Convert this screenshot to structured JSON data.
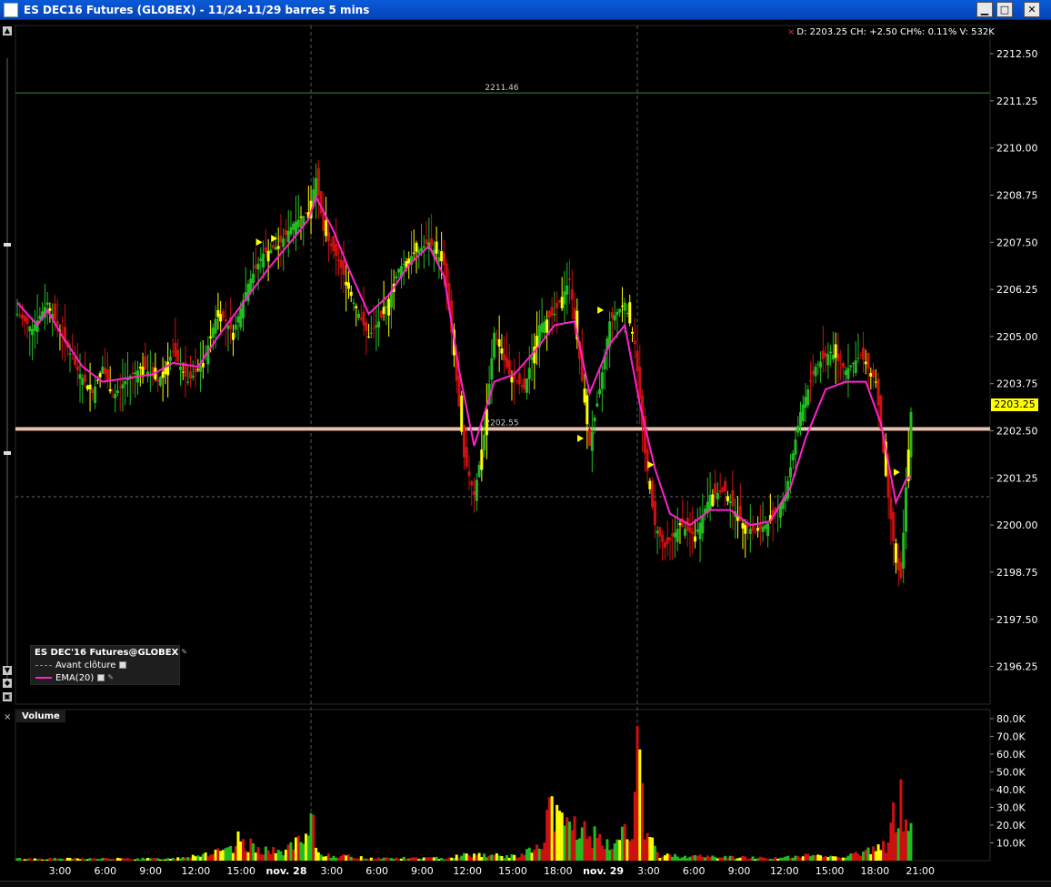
{
  "window": {
    "title": "ES DEC16 Futures (GLOBEX) - 11/24-11/29 barres 5 mins",
    "minimize_glyph": "▁",
    "maximize_glyph": "□",
    "close_glyph": "✕"
  },
  "info_line": {
    "close_glyph": "×",
    "text": "D: 2203.25 CH: +2.50 CH%: 0.11% V: 532K"
  },
  "last_price_label": "2203.25",
  "legend": {
    "title": "ES DEC'16 Futures@GLOBEX",
    "items": [
      {
        "label": "Avant clôture",
        "style": "dashed",
        "color": "#888888"
      },
      {
        "label": "EMA(20)",
        "style": "solid",
        "color": "#ff22cc"
      }
    ]
  },
  "volume_panel": {
    "label": "Volume",
    "close_glyph": "×"
  },
  "colors": {
    "up": "#22bb22",
    "down": "#cc1111",
    "neutral": "#ffff00",
    "ema": "#ff22cc",
    "grid": "#2a3a2a",
    "axis_text": "#ffffff",
    "reference_line_upper": "#2f8f2f",
    "reference_line_lower": "#e8c0b0",
    "marker": "#ffff00"
  },
  "chart_data": {
    "type": "candlestick",
    "price_axis": {
      "ticks": [
        "2212.50",
        "2211.25",
        "2210.00",
        "2208.75",
        "2207.50",
        "2206.25",
        "2205.00",
        "2203.75",
        "2202.50",
        "2201.25",
        "2200.00",
        "2198.75",
        "2197.50",
        "2196.25"
      ],
      "range": [
        2195.25,
        2213.25
      ]
    },
    "time_axis": {
      "labels": [
        "3:00",
        "6:00",
        "9:00",
        "12:00",
        "15:00",
        "nov. 28",
        "3:00",
        "6:00",
        "9:00",
        "12:00",
        "15:00",
        "18:00",
        "nov. 29",
        "3:00",
        "6:00",
        "9:00",
        "12:00",
        "15:00",
        "18:00",
        "21:00"
      ],
      "bold": [
        false,
        false,
        false,
        false,
        false,
        true,
        false,
        false,
        false,
        false,
        false,
        false,
        true,
        false,
        false,
        false,
        false,
        false,
        false,
        false
      ]
    },
    "reference_lines": [
      {
        "label": "2211.46",
        "value": 2211.46
      },
      {
        "label": "2202.55",
        "value": 2202.55
      }
    ],
    "pre_close_value": 2200.75,
    "price_path": [
      [
        0,
        2205.6
      ],
      [
        6,
        2205.2
      ],
      [
        12,
        2205.9
      ],
      [
        18,
        2205.0
      ],
      [
        24,
        2204.1
      ],
      [
        30,
        2203.5
      ],
      [
        34,
        2204.2
      ],
      [
        38,
        2203.4
      ],
      [
        44,
        2203.9
      ],
      [
        50,
        2204.2
      ],
      [
        56,
        2203.8
      ],
      [
        62,
        2204.6
      ],
      [
        68,
        2203.8
      ],
      [
        74,
        2204.3
      ],
      [
        80,
        2205.7
      ],
      [
        86,
        2205.1
      ],
      [
        92,
        2206.4
      ],
      [
        98,
        2207.2
      ],
      [
        104,
        2207.4
      ],
      [
        110,
        2208.0
      ],
      [
        116,
        2208.3
      ],
      [
        119,
        2209.2
      ],
      [
        122,
        2207.8
      ],
      [
        128,
        2207.0
      ],
      [
        134,
        2205.9
      ],
      [
        140,
        2205.0
      ],
      [
        146,
        2205.6
      ],
      [
        152,
        2206.8
      ],
      [
        158,
        2207.2
      ],
      [
        164,
        2207.5
      ],
      [
        170,
        2206.9
      ],
      [
        174,
        2204.5
      ],
      [
        178,
        2201.8
      ],
      [
        182,
        2200.8
      ],
      [
        186,
        2202.4
      ],
      [
        190,
        2205.1
      ],
      [
        196,
        2204.0
      ],
      [
        202,
        2203.6
      ],
      [
        208,
        2205.3
      ],
      [
        214,
        2205.6
      ],
      [
        220,
        2206.5
      ],
      [
        224,
        2204.4
      ],
      [
        228,
        2202.1
      ],
      [
        232,
        2203.6
      ],
      [
        236,
        2205.4
      ],
      [
        242,
        2205.9
      ],
      [
        246,
        2204.8
      ],
      [
        250,
        2201.9
      ],
      [
        254,
        2200.0
      ],
      [
        258,
        2199.4
      ],
      [
        264,
        2200.0
      ],
      [
        270,
        2199.7
      ],
      [
        276,
        2200.8
      ],
      [
        282,
        2200.9
      ],
      [
        288,
        2200.1
      ],
      [
        294,
        2199.8
      ],
      [
        300,
        2200.1
      ],
      [
        306,
        2200.8
      ],
      [
        312,
        2203.0
      ],
      [
        318,
        2204.2
      ],
      [
        324,
        2204.6
      ],
      [
        330,
        2204.1
      ],
      [
        336,
        2204.5
      ],
      [
        342,
        2203.8
      ],
      [
        346,
        2201.3
      ],
      [
        350,
        2199.0
      ],
      [
        352,
        2198.6
      ],
      [
        354,
        2201.0
      ],
      [
        356,
        2203.0
      ]
    ],
    "ema_path": [
      [
        0,
        2205.9
      ],
      [
        8,
        2205.3
      ],
      [
        12,
        2205.7
      ],
      [
        18,
        2205.0
      ],
      [
        26,
        2204.2
      ],
      [
        34,
        2203.8
      ],
      [
        44,
        2203.9
      ],
      [
        54,
        2204.0
      ],
      [
        62,
        2204.3
      ],
      [
        72,
        2204.2
      ],
      [
        80,
        2205.0
      ],
      [
        90,
        2205.9
      ],
      [
        100,
        2206.8
      ],
      [
        110,
        2207.6
      ],
      [
        116,
        2208.1
      ],
      [
        119,
        2208.7
      ],
      [
        126,
        2207.8
      ],
      [
        132,
        2206.8
      ],
      [
        140,
        2205.6
      ],
      [
        148,
        2206.1
      ],
      [
        156,
        2206.9
      ],
      [
        164,
        2207.4
      ],
      [
        170,
        2206.6
      ],
      [
        176,
        2204.1
      ],
      [
        182,
        2202.1
      ],
      [
        190,
        2203.8
      ],
      [
        198,
        2204.0
      ],
      [
        206,
        2204.6
      ],
      [
        214,
        2205.3
      ],
      [
        222,
        2205.4
      ],
      [
        228,
        2203.5
      ],
      [
        236,
        2204.8
      ],
      [
        242,
        2205.3
      ],
      [
        248,
        2203.2
      ],
      [
        254,
        2201.5
      ],
      [
        260,
        2200.3
      ],
      [
        268,
        2200.0
      ],
      [
        276,
        2200.4
      ],
      [
        284,
        2200.4
      ],
      [
        292,
        2200.0
      ],
      [
        300,
        2200.1
      ],
      [
        308,
        2201.0
      ],
      [
        314,
        2202.3
      ],
      [
        322,
        2203.6
      ],
      [
        330,
        2203.8
      ],
      [
        338,
        2203.8
      ],
      [
        344,
        2202.7
      ],
      [
        350,
        2200.6
      ],
      [
        354,
        2201.2
      ],
      [
        356,
        2201.3
      ]
    ],
    "volume_axis": {
      "ticks": [
        "80.0K",
        "70.0K",
        "60.0K",
        "50.0K",
        "40.0K",
        "30.0K",
        "20.0K",
        "10.0K"
      ],
      "range": [
        0,
        82000
      ]
    },
    "volume_spikes": [
      [
        0,
        1500
      ],
      [
        30,
        1500
      ],
      [
        60,
        1500
      ],
      [
        86,
        8000
      ],
      [
        88,
        15000
      ],
      [
        92,
        12000
      ],
      [
        96,
        10000
      ],
      [
        104,
        6000
      ],
      [
        110,
        12000
      ],
      [
        116,
        15000
      ],
      [
        117,
        33000
      ],
      [
        120,
        5000
      ],
      [
        140,
        2000
      ],
      [
        170,
        2000
      ],
      [
        176,
        4000
      ],
      [
        184,
        5000
      ],
      [
        196,
        3000
      ],
      [
        200,
        4000
      ],
      [
        210,
        12000
      ],
      [
        212,
        42000
      ],
      [
        214,
        30000
      ],
      [
        218,
        32000
      ],
      [
        224,
        24000
      ],
      [
        230,
        18000
      ],
      [
        234,
        10000
      ],
      [
        238,
        14000
      ],
      [
        244,
        30000
      ],
      [
        246,
        38000
      ],
      [
        247,
        80000
      ],
      [
        250,
        20000
      ],
      [
        256,
        4000
      ],
      [
        300,
        2000
      ],
      [
        312,
        3000
      ],
      [
        318,
        5000
      ],
      [
        324,
        3000
      ],
      [
        330,
        4000
      ],
      [
        342,
        8000
      ],
      [
        346,
        12000
      ],
      [
        350,
        38000
      ],
      [
        352,
        44000
      ],
      [
        354,
        30000
      ],
      [
        356,
        24000
      ]
    ],
    "markers": [
      {
        "bar": 98,
        "value": 2207.5
      },
      {
        "bar": 104,
        "value": 2207.6
      },
      {
        "bar": 226,
        "value": 2202.3
      },
      {
        "bar": 234,
        "value": 2205.7
      },
      {
        "bar": 254,
        "value": 2201.6
      },
      {
        "bar": 352,
        "value": 2201.4
      }
    ]
  }
}
